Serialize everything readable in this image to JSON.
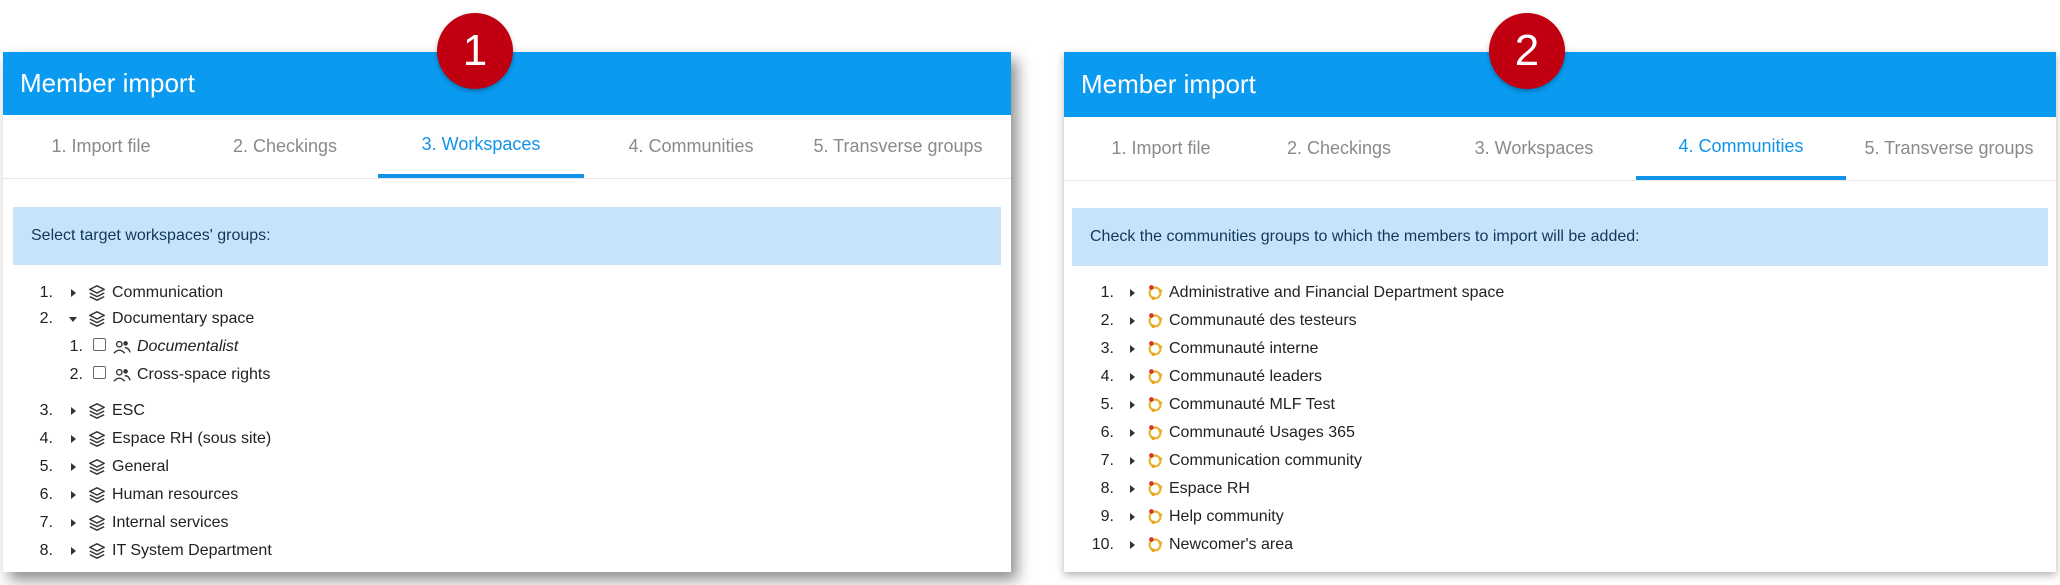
{
  "badges": [
    "1",
    "2"
  ],
  "panel1": {
    "title": "Member import",
    "tabs": [
      "1. Import file",
      "2. Checkings",
      "3. Workspaces",
      "4. Communities",
      "5. Transverse groups"
    ],
    "info": "Select target workspaces' groups:",
    "items": [
      {
        "num": "1.",
        "label": "Communication"
      },
      {
        "num": "2.",
        "label": "Documentary space"
      },
      {
        "num": "1.",
        "label": "Documentalist"
      },
      {
        "num": "2.",
        "label": "Cross-space rights"
      },
      {
        "num": "3.",
        "label": "ESC"
      },
      {
        "num": "4.",
        "label": "Espace RH (sous site)"
      },
      {
        "num": "5.",
        "label": "General"
      },
      {
        "num": "6.",
        "label": "Human resources"
      },
      {
        "num": "7.",
        "label": "Internal services"
      },
      {
        "num": "8.",
        "label": "IT System Department"
      }
    ]
  },
  "panel2": {
    "title": "Member import",
    "tabs": [
      "1. Import file",
      "2. Checkings",
      "3. Workspaces",
      "4. Communities",
      "5. Transverse groups"
    ],
    "info": "Check the communities groups to which the members to import will be added:",
    "items": [
      {
        "num": "1.",
        "label": "Administrative and Financial Department space"
      },
      {
        "num": "2.",
        "label": "Communauté des testeurs"
      },
      {
        "num": "3.",
        "label": "Communauté interne"
      },
      {
        "num": "4.",
        "label": "Communauté leaders"
      },
      {
        "num": "5.",
        "label": "Communauté MLF Test"
      },
      {
        "num": "6.",
        "label": "Communauté Usages 365"
      },
      {
        "num": "7.",
        "label": "Communication community"
      },
      {
        "num": "8.",
        "label": "Espace RH"
      },
      {
        "num": "9.",
        "label": "Help community"
      },
      {
        "num": "10.",
        "label": "Newcomer's area"
      }
    ]
  },
  "colors": {
    "header": "#0a9af0",
    "active_tab": "#1193e8",
    "info_bg": "#c7e3fb",
    "badge": "#c00010"
  },
  "icons": {
    "workspace": "layers-icon",
    "group": "user-group-icon",
    "community": "community-ring-icon",
    "expand": "caret-right-icon",
    "collapse": "caret-down-icon"
  }
}
